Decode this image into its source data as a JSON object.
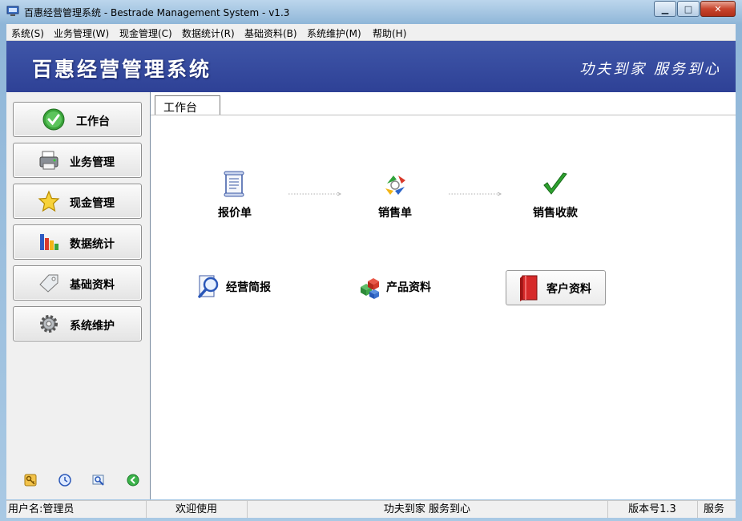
{
  "window": {
    "title": "百惠经营管理系统 - Bestrade Management System - v1.3",
    "min_label": "▁",
    "max_label": "□",
    "close_label": "✕"
  },
  "menu": [
    "系统(S)",
    "业务管理(W)",
    "现金管理(C)",
    "数据统计(R)",
    "基础资料(B)",
    "系统维护(M)",
    "帮助(H)"
  ],
  "banner": {
    "title": "百惠经营管理系统",
    "slogan": "功夫到家 服务到心",
    "color": "#3a4fa3"
  },
  "sidebar": {
    "items": [
      {
        "label": "工作台",
        "icon": "check-circle-icon"
      },
      {
        "label": "业务管理",
        "icon": "printer-icon"
      },
      {
        "label": "现金管理",
        "icon": "star-icon"
      },
      {
        "label": "数据统计",
        "icon": "bar-chart-icon"
      },
      {
        "label": "基础资料",
        "icon": "tag-icon"
      },
      {
        "label": "系统维护",
        "icon": "gear-icon"
      }
    ],
    "tools": [
      "key-icon",
      "clock-icon",
      "search-window-icon",
      "green-back-icon"
    ]
  },
  "content": {
    "tab": "工作台",
    "flow": [
      {
        "label": "报价单",
        "icon": "document-icon"
      },
      {
        "label": "销售单",
        "icon": "recycle-arrows-icon"
      },
      {
        "label": "销售收款",
        "icon": "green-check-icon"
      }
    ],
    "items": [
      {
        "label": "经营简报",
        "icon": "magnifier-report-icon"
      },
      {
        "label": "产品资料",
        "icon": "cubes-icon"
      },
      {
        "label": "客户资料",
        "icon": "red-book-icon"
      }
    ]
  },
  "status": {
    "user": "用户名:管理员",
    "welcome": "欢迎使用",
    "slogan": "功夫到家 服务到心",
    "version": "版本号1.3",
    "extra": "服务"
  }
}
